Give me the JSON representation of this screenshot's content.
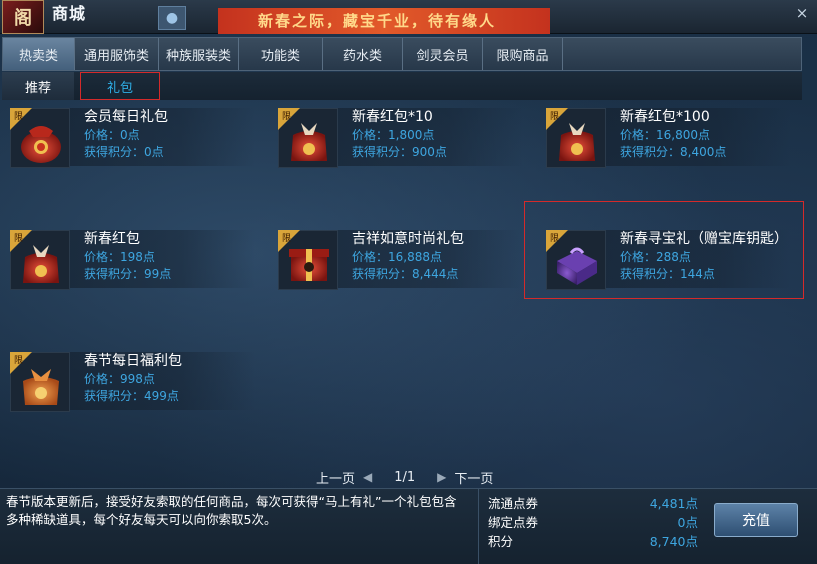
{
  "window": {
    "title": "商城",
    "banner_text": "新春之际，藏宝千业，待有缘人",
    "close_label": "×",
    "logo_glyph": "阁"
  },
  "category_tabs": [
    {
      "label": "热卖类",
      "active": true
    },
    {
      "label": "通用服饰类",
      "active": false
    },
    {
      "label": "种族服装类",
      "active": false
    },
    {
      "label": "功能类",
      "active": false
    },
    {
      "label": "药水类",
      "active": false
    },
    {
      "label": "剑灵会员",
      "active": false
    },
    {
      "label": "限购商品",
      "active": false
    }
  ],
  "sub_tabs": [
    {
      "label": "推荐",
      "selected": true
    },
    {
      "label": "礼包",
      "selected": false
    }
  ],
  "items": [
    {
      "name": "会员每日礼包",
      "price": "价格：0点",
      "points": "获得积分：0点",
      "icon": "red-pouch-icon"
    },
    {
      "name": "新春红包*10",
      "price": "价格：1,800点",
      "points": "获得积分：900点",
      "icon": "red-envelope-bag-icon"
    },
    {
      "name": "新春红包*100",
      "price": "价格：16,800点",
      "points": "获得积分：8,400点",
      "icon": "red-envelope-bag-icon"
    },
    {
      "name": "新春红包",
      "price": "价格：198点",
      "points": "获得积分：99点",
      "icon": "red-envelope-bag-icon"
    },
    {
      "name": "吉祥如意时尚礼包",
      "price": "价格：16,888点",
      "points": "获得积分：8,444点",
      "icon": "red-gift-box-icon"
    },
    {
      "name": "新春寻宝礼（赠宝库钥匙）",
      "price": "价格：288点",
      "points": "获得积分：144点",
      "icon": "purple-gift-box-icon"
    },
    {
      "name": "春节每日福利包",
      "price": "价格：998点",
      "points": "获得积分：499点",
      "icon": "orange-pouch-icon"
    }
  ],
  "item_badge": "限",
  "pager": {
    "prev": "上一页",
    "next": "下一页",
    "page": "1/1"
  },
  "notice": "春节版本更新后，接受好友索取的任何商品，每次可获得“马上有礼”一个礼包包含多种稀缺道具，每个好友每天可以向你索取5次。",
  "balances": [
    {
      "label": "流通点券",
      "value": "4,481点"
    },
    {
      "label": "绑定点券",
      "value": "0点"
    },
    {
      "label": "积分",
      "value": "8,740点"
    }
  ],
  "recharge_label": "充值",
  "colors": {
    "accent_blue": "#3ea6e0",
    "highlight_red": "#d42a2a",
    "ribbon_gold": "#d9a53a"
  }
}
